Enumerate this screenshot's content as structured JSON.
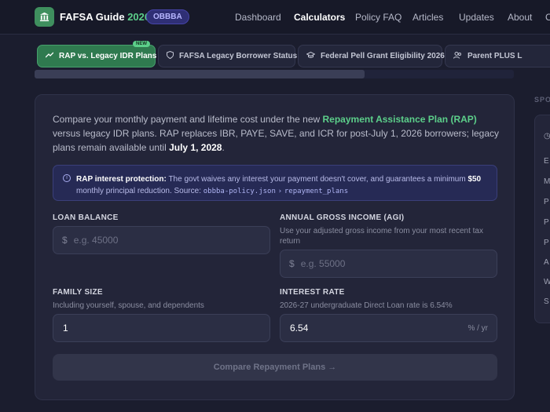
{
  "header": {
    "logo_text": "FAFSA Guide",
    "logo_year": "2026",
    "badge": "OBBBA",
    "nav": [
      "Dashboard",
      "Calculators",
      "Policy FAQ",
      "Articles",
      "Updates",
      "About",
      "C"
    ],
    "active_nav": "Calculators"
  },
  "tabs": [
    {
      "label": "RAP vs. Legacy IDR Plans",
      "icon": "trending-up-icon",
      "active": true,
      "badge": "NEW"
    },
    {
      "label": "FAFSA Legacy Borrower Status",
      "icon": "shield-icon",
      "active": false
    },
    {
      "label": "Federal Pell Grant Eligibility 2026",
      "icon": "graduation-cap-icon",
      "active": false
    },
    {
      "label": "Parent PLUS L",
      "icon": "users-icon",
      "active": false
    }
  ],
  "intro": {
    "p1": "Compare your monthly payment and lifetime cost under the new ",
    "highlight": "Repayment Assistance Plan (RAP)",
    "p2": " versus legacy IDR plans. RAP replaces IBR, PAYE, SAVE, and ICR for post-July 1, 2026 borrowers; legacy plans remain available until ",
    "date": "July 1, 2028",
    "p3": "."
  },
  "notice": {
    "title": "RAP interest protection:",
    "text": " The govt waives any interest your payment doesn't cover, and guarantees a minimum ",
    "amount": "$50",
    "text2": " monthly principal reduction. Source: ",
    "source": "obbba-policy.json",
    "arrow": "›",
    "field": "repayment_plans"
  },
  "form": {
    "loan_balance": {
      "label": "LOAN BALANCE",
      "prefix": "$",
      "placeholder": "e.g. 45000"
    },
    "agi": {
      "label": "ANNUAL GROSS INCOME (AGI)",
      "helper": "Use your adjusted gross income from your most recent tax return",
      "prefix": "$",
      "placeholder": "e.g. 55000"
    },
    "family": {
      "label": "FAMILY SIZE",
      "helper": "Including yourself, spouse, and dependents",
      "value": "1"
    },
    "rate": {
      "label": "INTEREST RATE",
      "helper": "2026-27 undergraduate Direct Loan rate is 6.54%",
      "value": "6.54",
      "suffix": "% / yr"
    },
    "submit": "Compare Repayment Plans →"
  },
  "sidebar": {
    "title": "SPO",
    "items": [
      "E",
      "M",
      "P",
      "P",
      "P",
      "A",
      "W",
      "S"
    ]
  },
  "colors": {
    "accent": "#5ccf8a",
    "background": "#1b1d2e",
    "card": "#232539",
    "notice": "#262a55"
  }
}
